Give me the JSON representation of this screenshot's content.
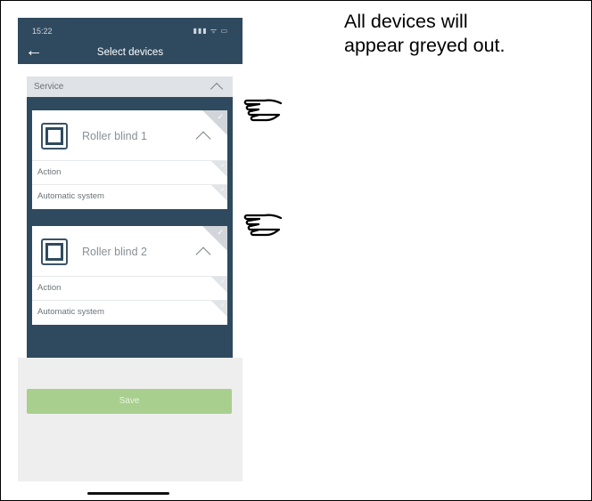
{
  "status_bar": {
    "time": "15:22",
    "icons": "▮▮▮ ᯤ ▭"
  },
  "nav": {
    "title": "Select devices",
    "back_icon": "back-arrow-icon"
  },
  "service": {
    "label": "Service"
  },
  "devices": [
    {
      "name": "Roller blind 1",
      "rows": [
        "Action",
        "Automatic system"
      ]
    },
    {
      "name": "Roller blind 2",
      "rows": [
        "Action",
        "Automatic system"
      ]
    }
  ],
  "save": {
    "label": "Save"
  },
  "annotation": {
    "line1": "All devices will",
    "line2": "appear greyed out."
  },
  "colors": {
    "header": "#2f4a5e",
    "service_bar": "#dfe2e6",
    "save_button": "#a8cf8e",
    "bottom_panel": "#eeeeee"
  },
  "icons": {
    "pointer": "pointing-hand-icon",
    "device": "roller-blind-icon",
    "check": "checkmark-icon"
  }
}
